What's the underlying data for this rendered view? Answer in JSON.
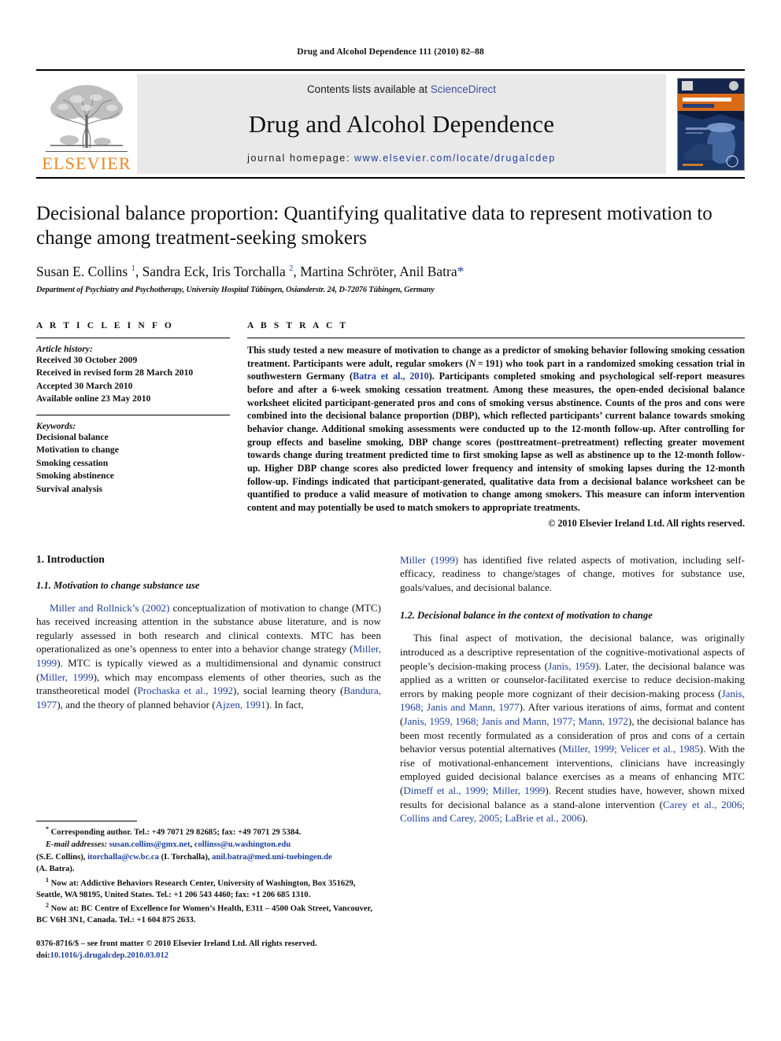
{
  "running_head": "Drug and Alcohol Dependence 111 (2010) 82–88",
  "masthead": {
    "publisher_name": "ELSEVIER",
    "contents_prefix": "Contents lists available at ",
    "contents_link": "ScienceDirect",
    "journal_title": "Drug and Alcohol Dependence",
    "homepage_prefix": "journal homepage: ",
    "homepage_url": "www.elsevier.com/locate/drugalcdep",
    "cover_title_line1": "DRUG AND ALCOHOL",
    "cover_title_line2": "Dependence",
    "accent_orange": "#F3841F",
    "link_blue": "#1E3FA0",
    "cover_dark": "#0d1a3a"
  },
  "article": {
    "title": "Decisional balance proportion: Quantifying qualitative data to represent motivation to change among treatment-seeking smokers",
    "authors_html": "Susan E. Collins <sup>1</sup>, Sandra Eck, Iris Torchalla <sup>2</sup>, Martina Schröter, Anil Batra<span class=\"star\">*</span>",
    "affiliation": "Department of Psychiatry and Psychotherapy, University Hospital Tübingen, Osianderstr. 24, D-72076 Tübingen, Germany"
  },
  "article_info": {
    "label": "A R T I C L E   I N F O",
    "history_label": "Article history:",
    "history": [
      "Received 30 October 2009",
      "Received in revised form 28 March 2010",
      "Accepted 30 March 2010",
      "Available online 23 May 2010"
    ],
    "keywords_label": "Keywords:",
    "keywords": [
      "Decisional balance",
      "Motivation to change",
      "Smoking cessation",
      "Smoking abstinence",
      "Survival analysis"
    ]
  },
  "abstract": {
    "label": "A B S T R A C T",
    "html": "This study tested a new measure of motivation to change as a predictor of smoking behavior following smoking cessation treatment. Participants were adult, regular smokers (<i>N</i>&#8239;=&#8239;191) who took part in a randomized smoking cessation trial in southwestern Germany (<span class=\"ref\">Batra et al., 2010</span>). Participants completed smoking and psychological self-report measures before and after a 6-week smoking cessation treatment. Among these measures, the open-ended decisional balance worksheet elicited participant-generated pros and cons of smoking versus abstinence. Counts of the pros and cons were combined into the decisional balance proportion (DBP), which reflected participants&#8217; current balance towards smoking behavior change. Additional smoking assessments were conducted up to the 12-month follow-up. After controlling for group effects and baseline smoking, DBP change scores (posttreatment&#8211;pretreatment) reflecting greater movement towards change during treatment predicted time to first smoking lapse as well as abstinence up to the 12-month follow-up. Higher DBP change scores also predicted lower frequency and intensity of smoking lapses during the 12-month follow-up. Findings indicated that participant-generated, qualitative data from a decisional balance worksheet can be quantified to produce a valid measure of motivation to change among smokers. This measure can inform intervention content and may potentially be used to match smokers to appropriate treatments.",
    "copyright": "© 2010 Elsevier Ireland Ltd. All rights reserved."
  },
  "body": {
    "heading_1": "1.  Introduction",
    "heading_1_1": "1.1.  Motivation to change substance use",
    "heading_1_2": "1.2.  Decisional balance in the context of motivation to change",
    "para_left_1_html": "<span class=\"ref\">Miller and Rollnick&#8217;s (2002)</span> conceptualization of motivation to change (MTC) has received increasing attention in the substance abuse literature, and is now regularly assessed in both research and clinical contexts. MTC has been operationalized as one&#8217;s openness to enter into a behavior change strategy (<span class=\"ref\">Miller, 1999</span>). MTC is typically viewed as a multidimensional and dynamic construct (<span class=\"ref\">Miller, 1999</span>), which may encompass elements of other theories, such as the transtheoretical model (<span class=\"ref\">Prochaska et al., 1992</span>), social learning theory (<span class=\"ref\">Bandura, 1977</span>), and the theory of planned behavior (<span class=\"ref\">Ajzen, 1991</span>). In fact,",
    "para_right_1_html": "<span class=\"ref\">Miller (1999)</span> has identified five related aspects of motivation, including self-efficacy, readiness to change/stages of change, motives for substance use, goals/values, and decisional balance.",
    "para_right_2_html": "This final aspect of motivation, the decisional balance, was originally introduced as a descriptive representation of the cognitive-motivational aspects of people&#8217;s decision-making process (<span class=\"ref\">Janis, 1959</span>). Later, the decisional balance was applied as a written or counselor-facilitated exercise to reduce decision-making errors by making people more cognizant of their decision-making process (<span class=\"ref\">Janis, 1968; Janis and Mann, 1977</span>). After various iterations of aims, format and content (<span class=\"ref\">Janis, 1959, 1968; Janis and Mann, 1977; Mann, 1972</span>), the decisional balance has been most recently formulated as a consideration of pros and cons of a certain behavior versus potential alternatives (<span class=\"ref\">Miller, 1999; Velicer et al., 1985</span>). With the rise of motivational-enhancement interventions, clinicians have increasingly employed guided decisional balance exercises as a means of enhancing MTC (<span class=\"ref\">Dimeff et al., 1999; Miller, 1999</span>). Recent studies have, however, shown mixed results for decisional balance as a stand-alone intervention (<span class=\"ref\">Carey et al., 2006; Collins and Carey, 2005; LaBrie et al., 2006</span>)."
  },
  "footnotes": {
    "corresponding_html": "<sup>*</sup> Corresponding author. Tel.: +49 7071 29 82685; fax: +49 7071 29 5384.",
    "email_html": "<span class=\"em\">E-mail addresses:</span> <span class=\"lnk\">susan.collins@gmx.net</span>, <span class=\"lnk\">collinss@u.washington.edu</span>",
    "email_html_2": "(S.E. Collins), <span class=\"lnk\">itorchalla@cw.bc.ca</span> (I. Torchalla), <span class=\"lnk\">anil.batra@med.uni-tuebingen.de</span>",
    "email_html_3": "(A. Batra).",
    "fn1_html": "<sup>1</sup> Now at: Addictive Behaviors Research Center, University of Washington, Box 351629, Seattle, WA 98195, United States. Tel.: +1 206 543 4460; fax: +1 206 685 1310.",
    "fn2_html": "<sup>2</sup> Now at: BC Centre of Excellence for Women&#8217;s Health, E311 – 4500 Oak Street, Vancouver, BC V6H 3N1, Canada. Tel.: +1 604 875 2633.",
    "issn_line_html": "0376-8716/$ – see front matter © 2010 Elsevier Ireland Ltd. All rights reserved.",
    "doi_html": "doi:<span class=\"lnk\">10.1016/j.drugalcdep.2010.03.012</span>"
  }
}
